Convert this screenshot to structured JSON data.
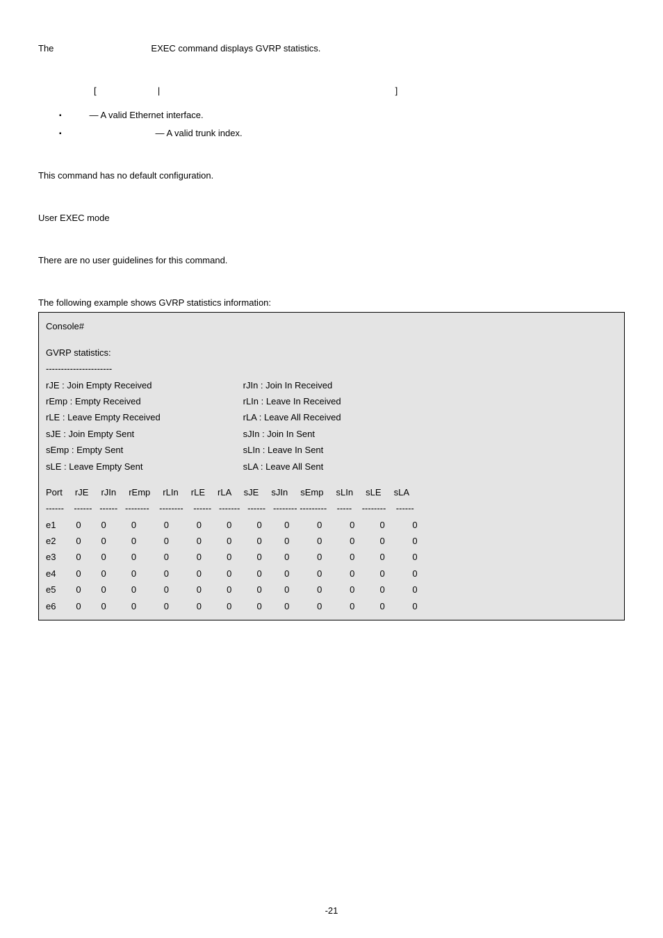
{
  "intro": {
    "left": "The",
    "right": "EXEC command displays GVRP statistics."
  },
  "syntax": {
    "lbr": "[",
    "pipe": "|",
    "rbr": "]"
  },
  "bullets": {
    "b1": "— A valid Ethernet interface.",
    "b2": "— A valid trunk index."
  },
  "paras": {
    "p1": "This command has no default configuration.",
    "p2": "User EXEC mode",
    "p3": "There are no user guidelines for this command.",
    "p4": "The following example shows GVRP statistics information:"
  },
  "box": {
    "console": "Console#",
    "stats": "GVRP statistics:",
    "dashes": "----------------------",
    "legend": {
      "l1a": "rJE : Join Empty Received",
      "l1b": "rJIn : Join In Received",
      "l2a": "rEmp : Empty Received",
      "l2b": "rLIn : Leave In Received",
      "l3a": "rLE : Leave Empty Received",
      "l3b": "rLA : Leave All Received",
      "l4a": "sJE : Join Empty Sent",
      "l4b": "sJIn : Join In Sent",
      "l5a": "sEmp : Empty Sent",
      "l5b": "sLIn : Leave In Sent",
      "l6a": "sLE : Leave Empty Sent",
      "l6b": "sLA : Leave All Sent"
    },
    "header": "Port     rJE     rJIn     rEmp     rLIn     rLE     rLA     sJE     sJIn     sEmp     sLIn     sLE     sLA",
    "sep": "------    ------   ------   --------    --------    ------   -------   ------   -------- ---------    -----    --------    ------",
    "rows": {
      "r1": "e1        0        0          0           0           0          0          0         0           0           0          0           0",
      "r2": "e2        0        0          0           0           0          0          0         0           0           0          0           0",
      "r3": "e3        0        0          0           0           0          0          0         0           0           0          0           0",
      "r4": "e4        0        0          0           0           0          0          0         0           0           0          0           0",
      "r5": "e5        0        0          0           0           0          0          0         0           0           0          0           0",
      "r6": "e6        0        0          0           0           0          0          0         0           0           0          0           0"
    }
  },
  "pagenum": "-21",
  "chart_data": {
    "type": "table",
    "title": "GVRP statistics",
    "columns": [
      "Port",
      "rJE",
      "rJIn",
      "rEmp",
      "rLIn",
      "rLE",
      "rLA",
      "sJE",
      "sJIn",
      "sEmp",
      "sLIn",
      "sLE",
      "sLA"
    ],
    "rows": [
      [
        "e1",
        0,
        0,
        0,
        0,
        0,
        0,
        0,
        0,
        0,
        0,
        0,
        0
      ],
      [
        "e2",
        0,
        0,
        0,
        0,
        0,
        0,
        0,
        0,
        0,
        0,
        0,
        0
      ],
      [
        "e3",
        0,
        0,
        0,
        0,
        0,
        0,
        0,
        0,
        0,
        0,
        0,
        0
      ],
      [
        "e4",
        0,
        0,
        0,
        0,
        0,
        0,
        0,
        0,
        0,
        0,
        0,
        0
      ],
      [
        "e5",
        0,
        0,
        0,
        0,
        0,
        0,
        0,
        0,
        0,
        0,
        0,
        0
      ],
      [
        "e6",
        0,
        0,
        0,
        0,
        0,
        0,
        0,
        0,
        0,
        0,
        0,
        0
      ]
    ],
    "legend": {
      "rJE": "Join Empty Received",
      "rJIn": "Join In Received",
      "rEmp": "Empty Received",
      "rLIn": "Leave In Received",
      "rLE": "Leave Empty Received",
      "rLA": "Leave All Received",
      "sJE": "Join Empty Sent",
      "sJIn": "Join In Sent",
      "sEmp": "Empty Sent",
      "sLIn": "Leave In Sent",
      "sLE": "Leave Empty Sent",
      "sLA": "Leave All Sent"
    }
  }
}
